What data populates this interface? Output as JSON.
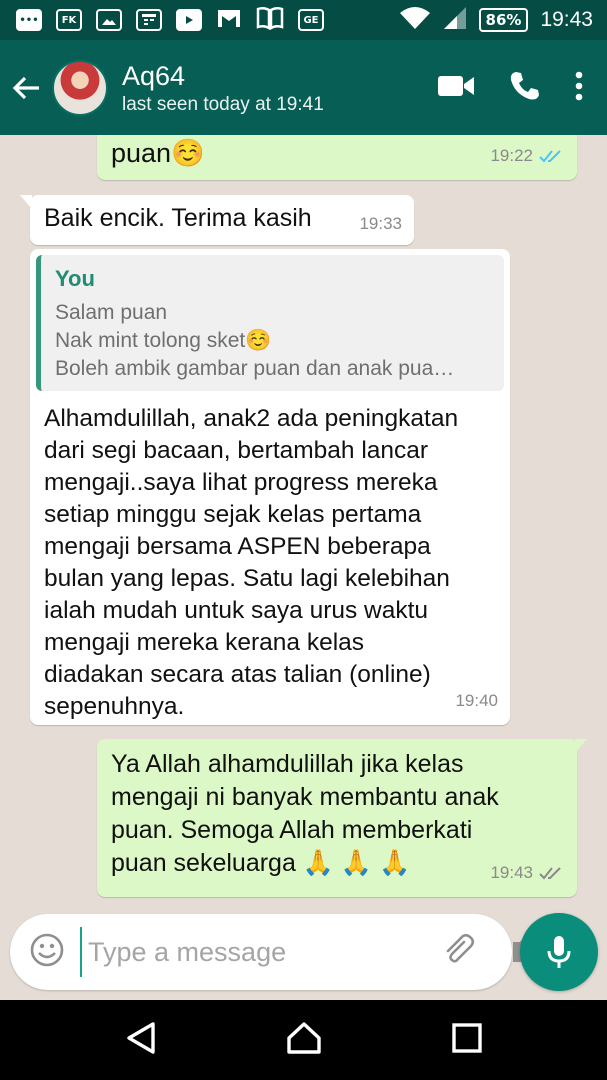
{
  "status_bar": {
    "battery": "86%",
    "time": "19:43",
    "icons": [
      "chat-bubble-icon",
      "fk-icon",
      "image-icon",
      "calendar-icon",
      "youtube-icon",
      "gmail-icon",
      "book-icon",
      "ge-icon",
      "wifi-icon",
      "signal-icon",
      "battery-icon"
    ],
    "fk_label": "FK",
    "ge_label": "GE"
  },
  "header": {
    "contact_name": "Aq64",
    "status": "last seen today at 19:41",
    "icons": [
      "back-arrow-icon",
      "video-call-icon",
      "phone-icon",
      "more-vert-icon"
    ]
  },
  "messages": [
    {
      "direction": "outgoing",
      "text": "puan☺️",
      "time": "19:22",
      "read": true
    },
    {
      "direction": "incoming",
      "text": "Baik encik. Terima kasih",
      "time": "19:33"
    },
    {
      "direction": "incoming",
      "quote": {
        "author": "You",
        "lines": [
          "Salam puan",
          "Nak mint tolong sket☺️",
          "Boleh ambik gambar puan dan anak pua…"
        ]
      },
      "lines": [
        "Alhamdulillah, anak2 ada peningkatan",
        "dari segi bacaan, bertambah lancar",
        "mengaji..saya lihat progress mereka",
        "setiap minggu sejak kelas pertama",
        "mengaji bersama ASPEN beberapa",
        "bulan yang lepas. Satu lagi kelebihan",
        "ialah mudah untuk saya urus waktu",
        "mengaji mereka kerana kelas",
        "diadakan secara atas talian (online)",
        "sepenuhnya."
      ],
      "time": "19:40"
    },
    {
      "direction": "outgoing",
      "lines": [
        "Ya Allah alhamdulillah jika kelas",
        "mengaji ni banyak membantu anak",
        "puan. Semoga Allah memberkati",
        "puan sekeluarga 🙏 🙏 🙏"
      ],
      "time": "19:43",
      "read": false
    }
  ],
  "composer": {
    "placeholder": "Type a message",
    "icons": [
      "emoji-icon",
      "attach-icon",
      "camera-icon",
      "mic-icon"
    ]
  },
  "nav_bar": {
    "icons": [
      "back-triangle-icon",
      "home-icon",
      "recents-icon"
    ]
  },
  "colors": {
    "status_bar": "#054d44",
    "app_bar": "#075e54",
    "chat_bg": "#e5ddd5",
    "outgoing_bubble": "#dcf8c6",
    "incoming_bubble": "#ffffff",
    "read_ticks": "#4fc3f7",
    "sent_ticks": "#8a8a8a",
    "mic_button": "#0a8d7b"
  }
}
